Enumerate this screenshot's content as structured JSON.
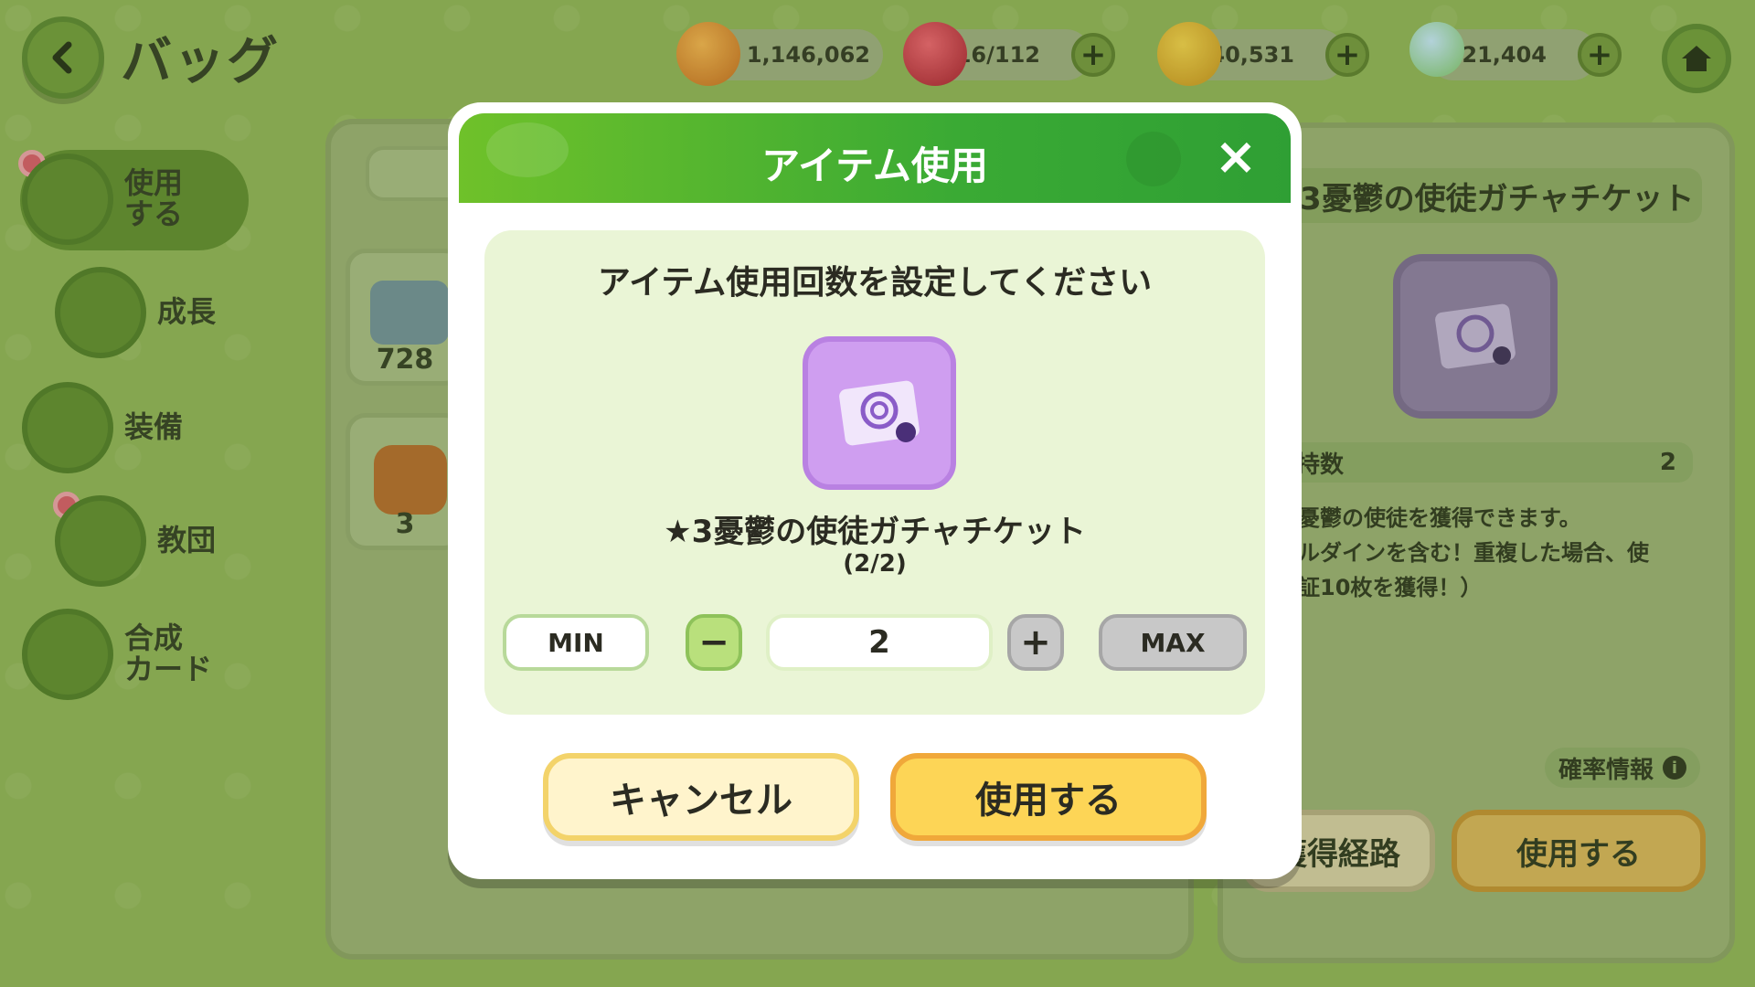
{
  "header": {
    "title": "バッグ",
    "resources": [
      {
        "icon": "bread-icon",
        "value": "1,146,062"
      },
      {
        "icon": "gem-icon",
        "value": "16/112"
      },
      {
        "icon": "coin-icon",
        "value": "1,240,531"
      },
      {
        "icon": "crystal-icon",
        "value": "21,404"
      }
    ]
  },
  "sidebar": {
    "items": [
      {
        "label": "使用\nする",
        "icon": "chest-icon"
      },
      {
        "label": "成長",
        "icon": "potion-icon"
      },
      {
        "label": "装備",
        "icon": "equipment-icon"
      },
      {
        "label": "教団",
        "icon": "guild-icon"
      },
      {
        "label": "合成\nカード",
        "icon": "card-icon"
      }
    ]
  },
  "left_panel": {
    "slots": [
      {
        "icon": "toolbox-icon",
        "count": "728"
      },
      {
        "icon": "bag-icon",
        "count": "3"
      }
    ]
  },
  "right_panel": {
    "title": "3憂鬱の使徒ガチャチケット",
    "held_label": "持数",
    "held_value": "2",
    "desc_lines": [
      "憂鬱の使徒を獲得できます。",
      "ルダインを含む！重複した場合、使",
      "証10枚を獲得！）"
    ],
    "prob_label": "確率情報",
    "acquire_label": "獲得経路",
    "use_label": "使用する"
  },
  "modal": {
    "title": "アイテム使用",
    "instruction": "アイテム使用回数を設定してください",
    "item_name": "★3憂鬱の使徒ガチャチケット",
    "item_count": "(2/2)",
    "min_label": "MIN",
    "max_label": "MAX",
    "quantity": "2",
    "cancel_label": "キャンセル",
    "use_label": "使用する"
  },
  "colors": {
    "header_green": "#3aaa34",
    "use_button": "#fdd556",
    "cancel_button": "#fff4cc",
    "item_purple": "#cf9ef0"
  }
}
